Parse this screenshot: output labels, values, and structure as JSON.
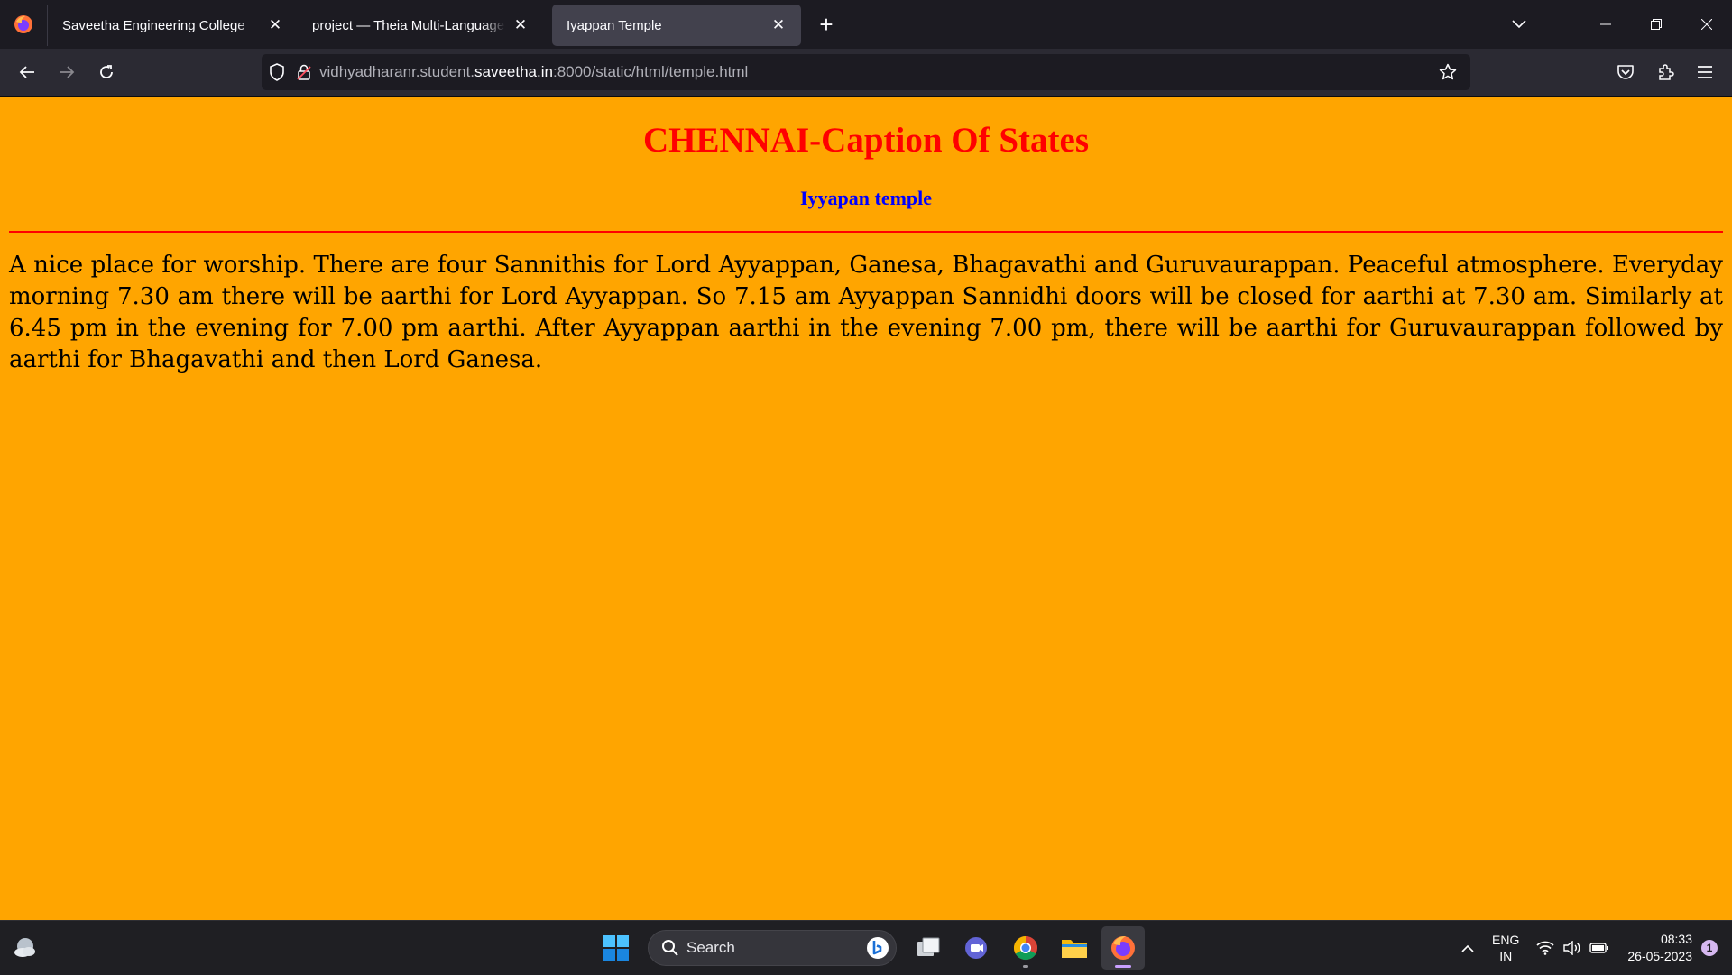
{
  "browser": {
    "tabs": [
      {
        "label": "Saveetha Engineering College",
        "active": false
      },
      {
        "label": "project — Theia Multi-Language Ex",
        "active": false
      },
      {
        "label": "Iyappan Temple",
        "active": true
      }
    ],
    "url": {
      "prefix": "vidhyadharanr.student.",
      "host": "saveetha.in",
      "suffix": ":8000/static/html/temple.html"
    }
  },
  "page": {
    "title": "CHENNAI-Caption Of States",
    "subtitle": "Iyyapan temple",
    "paragraph": "A nice place for worship. There are four Sannithis for Lord Ayyappan, Ganesa, Bhagavathi and Guruvaurappan. Peaceful atmosphere. Everyday morning 7.30 am there will be aarthi for Lord Ayyappan. So 7.15 am Ayyappan Sannidhi doors will be closed for aarthi at 7.30 am. Similarly at 6.45 pm in the evening for 7.00 pm aarthi. After Ayyappan aarthi in the evening 7.00 pm, there will be aarthi for Guruvaurappan followed by aarthi for Bhagavathi and then Lord Ganesa.",
    "colors": {
      "background": "#ffa500",
      "title": "#ff0000",
      "subtitle": "#0000ff",
      "rule": "#ff0000"
    }
  },
  "taskbar": {
    "search_label": "Search",
    "apps": [
      "start-icon",
      "task-view-icon",
      "teams-chat-icon",
      "chrome-icon",
      "file-explorer-icon",
      "firefox-icon"
    ],
    "language": {
      "line1": "ENG",
      "line2": "IN"
    },
    "time": "08:33",
    "date": "26-05-2023",
    "notification_count": "1"
  }
}
